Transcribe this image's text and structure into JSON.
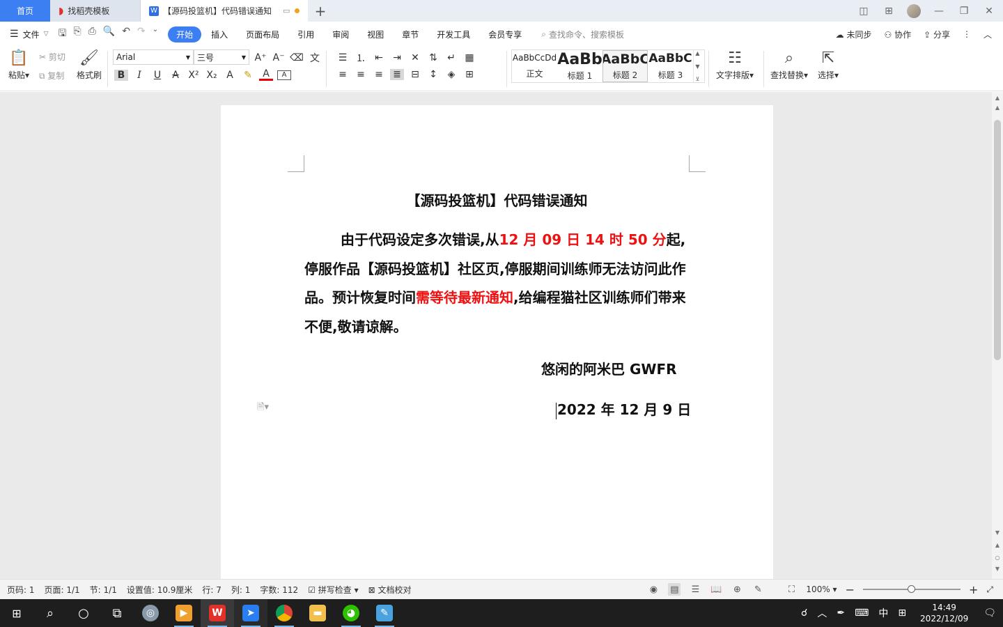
{
  "tabs": {
    "home": "首页",
    "template": "找稻壳模板",
    "document": "【源码投篮机】代码错误通知"
  },
  "menu": {
    "file": "文件",
    "items": [
      "开始",
      "插入",
      "页面布局",
      "引用",
      "审阅",
      "视图",
      "章节",
      "开发工具",
      "会员专享"
    ],
    "active_index": 0,
    "search_placeholder": "查找命令、搜索模板",
    "sync": "未同步",
    "collab": "协作",
    "share": "分享"
  },
  "ribbon": {
    "paste": "粘贴",
    "cut": "剪切",
    "copy": "复制",
    "format_painter": "格式刷",
    "font_name": "Arial",
    "font_size": "三号",
    "styles": [
      {
        "sample": "AaBbCcDd",
        "name": "正文"
      },
      {
        "sample": "AaBb",
        "name": "标题 1"
      },
      {
        "sample": "AaBbC",
        "name": "标题 2"
      },
      {
        "sample": "AaBbC",
        "name": "标题 3"
      }
    ],
    "text_layout": "文字排版",
    "find_replace": "查找替换",
    "select": "选择"
  },
  "document": {
    "title": "【源码投篮机】代码错误通知",
    "body_1": "由于代码设定多次错误,从",
    "body_red_1": "12 月 09 日 14 时 50 分",
    "body_2": "起,停服作品【源码投篮机】社区页,停服期间训练师无法访问此作品。预计恢复时间",
    "body_red_2": "需等待最新通知",
    "body_3": ",给编程猫社区训练师们带来不便,敬请谅解。",
    "signature": "悠闲的阿米巴 GWFR",
    "date": "2022 年 12 月 9 日"
  },
  "status": {
    "page_num": "页码: 1",
    "pages": "页面: 1/1",
    "section": "节: 1/1",
    "setting": "设置值: 10.9厘米",
    "row": "行: 7",
    "col": "列: 1",
    "word_count": "字数: 112",
    "spell_check": "拼写检查",
    "proofread": "文档校对",
    "zoom": "100%",
    "zoom_fraction": 0.5
  },
  "taskbar": {
    "time": "14:49",
    "date": "2022/12/09",
    "ime": "中"
  },
  "colors": {
    "accent": "#3b7ff2",
    "red_text": "#ee1111",
    "workspace": "#eaeaea",
    "taskbar": "#1e1e1e"
  }
}
